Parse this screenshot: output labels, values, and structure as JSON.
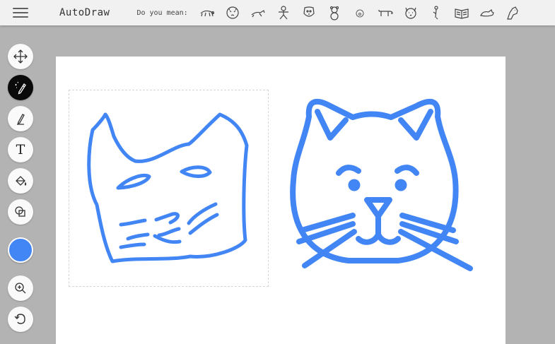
{
  "app": {
    "title": "AutoDraw",
    "suggest_label": "Do you mean:"
  },
  "suggestions": [
    {
      "icon": "crawling-animal-icon"
    },
    {
      "icon": "tiger-face-icon"
    },
    {
      "icon": "running-animal-icon"
    },
    {
      "icon": "gingerbread-man-icon"
    },
    {
      "icon": "dog-face-icon"
    },
    {
      "icon": "teddy-bear-icon"
    },
    {
      "icon": "small-pig-icon"
    },
    {
      "icon": "polar-bear-icon"
    },
    {
      "icon": "cat-face-icon"
    },
    {
      "icon": "meerkat-icon"
    },
    {
      "icon": "open-book-icon"
    },
    {
      "icon": "cat-lying-icon"
    },
    {
      "icon": "horse-head-icon"
    }
  ],
  "tools": [
    {
      "name": "move-tool",
      "icon": "move-arrows-icon"
    },
    {
      "name": "autodraw-tool",
      "icon": "magic-pencil-icon",
      "active": true
    },
    {
      "name": "draw-tool",
      "icon": "pencil-icon"
    },
    {
      "name": "type-tool",
      "icon": "text-t-icon",
      "label": "T"
    },
    {
      "name": "fill-tool",
      "icon": "paint-bucket-icon"
    },
    {
      "name": "shape-tool",
      "icon": "shapes-icon"
    }
  ],
  "color": {
    "selected": "#4285f4"
  },
  "bottom_tools": [
    {
      "name": "zoom-tool",
      "icon": "zoom-in-icon"
    },
    {
      "name": "undo-tool",
      "icon": "undo-icon"
    }
  ],
  "canvas": {
    "drawings": [
      {
        "name": "hand-drawn-cat",
        "kind": "sketch"
      },
      {
        "name": "autodraw-cat",
        "kind": "suggested-clipart"
      }
    ],
    "stroke_color": "#4285f4"
  }
}
